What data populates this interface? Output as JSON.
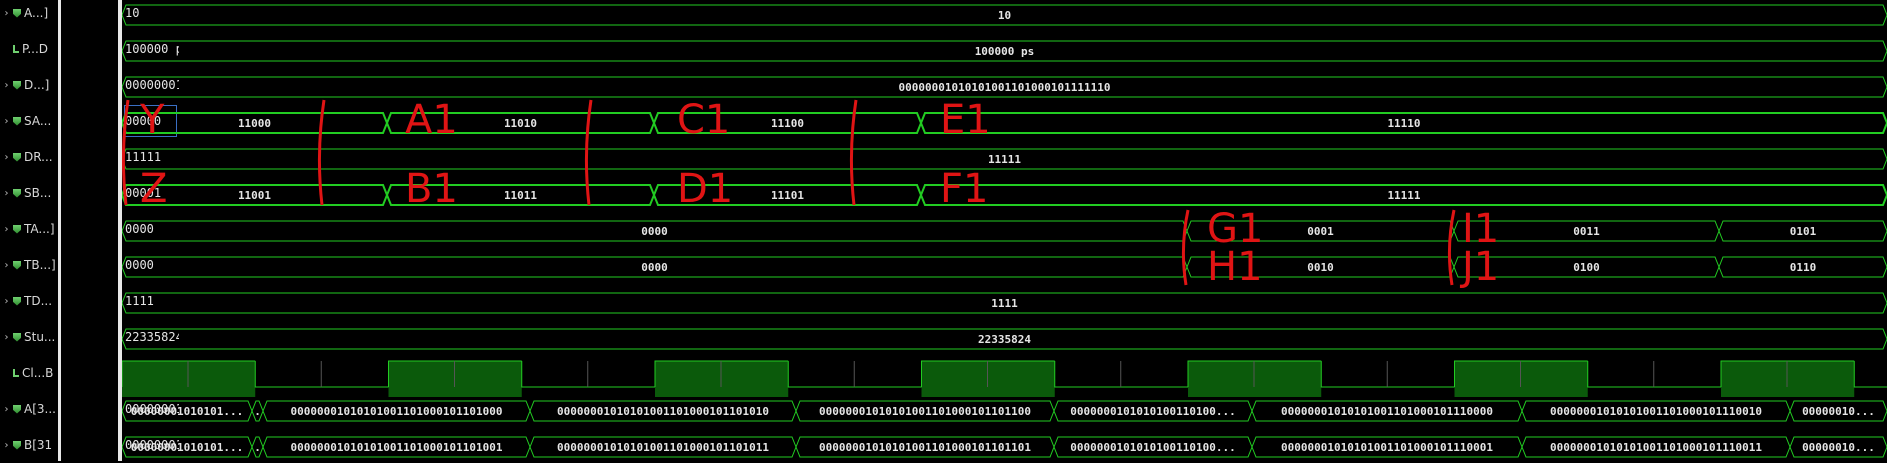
{
  "signals": [
    {
      "name": "A...]",
      "value": "10",
      "kind": "bus",
      "expand": true
    },
    {
      "name": "P...D",
      "value": "100000 ps",
      "kind": "bit",
      "expand": false
    },
    {
      "name": "D...]",
      "value": "00000001",
      "kind": "bus",
      "expand": true
    },
    {
      "name": "SA...",
      "value": "00000",
      "kind": "bus",
      "expand": true,
      "selected": true
    },
    {
      "name": "DR...",
      "value": "11111",
      "kind": "bus",
      "expand": true
    },
    {
      "name": "SB...",
      "value": "00001",
      "kind": "bus",
      "expand": true
    },
    {
      "name": "TA...]",
      "value": "0000",
      "kind": "bus",
      "expand": true
    },
    {
      "name": "TB...]",
      "value": "0000",
      "kind": "bus",
      "expand": true
    },
    {
      "name": "TD...",
      "value": "1111",
      "kind": "bus",
      "expand": true
    },
    {
      "name": "Stu...",
      "value": "22335824",
      "kind": "bus",
      "expand": true
    },
    {
      "name": "Cl...B",
      "value": "1",
      "kind": "bit",
      "expand": false
    },
    {
      "name": "A[3...",
      "value": "00000001",
      "kind": "bus",
      "expand": true
    },
    {
      "name": "B[31",
      "value": "00000001",
      "kind": "bus",
      "expand": true
    }
  ],
  "waveforms": {
    "row0": [
      {
        "label": "10"
      }
    ],
    "row1": [
      {
        "label": "100000 ps"
      }
    ],
    "row2": [
      {
        "label": "00000001010101001101000101111110"
      }
    ],
    "row3": [
      {
        "label": "11000"
      },
      {
        "label": "11010"
      },
      {
        "label": "11100"
      },
      {
        "label": "11110"
      }
    ],
    "row4": [
      {
        "label": "11111"
      }
    ],
    "row5": [
      {
        "label": "11001"
      },
      {
        "label": "11011"
      },
      {
        "label": "11101"
      },
      {
        "label": "11111"
      }
    ],
    "row6": [
      {
        "label": "0000"
      },
      {
        "label": "0001"
      },
      {
        "label": "0011"
      },
      {
        "label": "0101"
      }
    ],
    "row7": [
      {
        "label": "0000"
      },
      {
        "label": "0010"
      },
      {
        "label": "0100"
      },
      {
        "label": "0110"
      }
    ],
    "row8": [
      {
        "label": "1111"
      }
    ],
    "row9": [
      {
        "label": "22335824"
      }
    ],
    "row11": [
      {
        "label": "00000001010101..."
      },
      {
        "label": "."
      },
      {
        "label": "00000001010101001101000101101000"
      },
      {
        "label": "00000001010101001101000101101010"
      },
      {
        "label": "00000001010101001101000101101100"
      },
      {
        "label": "0000000101010100110100..."
      },
      {
        "label": "00000001010101001101000101110000"
      },
      {
        "label": "00000001010101001101000101110010"
      },
      {
        "label": "00000010..."
      }
    ],
    "row12": [
      {
        "label": "00000001010101..."
      },
      {
        "label": "."
      },
      {
        "label": "00000001010101001101000101101001"
      },
      {
        "label": "00000001010101001101000101101011"
      },
      {
        "label": "00000001010101001101000101101101"
      },
      {
        "label": "0000000101010100110100..."
      },
      {
        "label": "00000001010101001101000101110001"
      },
      {
        "label": "00000001010101001101000101110011"
      },
      {
        "label": "00000010..."
      }
    ]
  },
  "annotations": [
    "Y",
    "Z",
    "A1",
    "B1",
    "C1",
    "D1",
    "E1",
    "F1",
    "G1",
    "H1",
    "I1",
    "J1"
  ],
  "colors": {
    "wave": "#22cc22",
    "clock_fill": "#0b5a0b",
    "annotation": "#e01414",
    "background": "#000000"
  }
}
